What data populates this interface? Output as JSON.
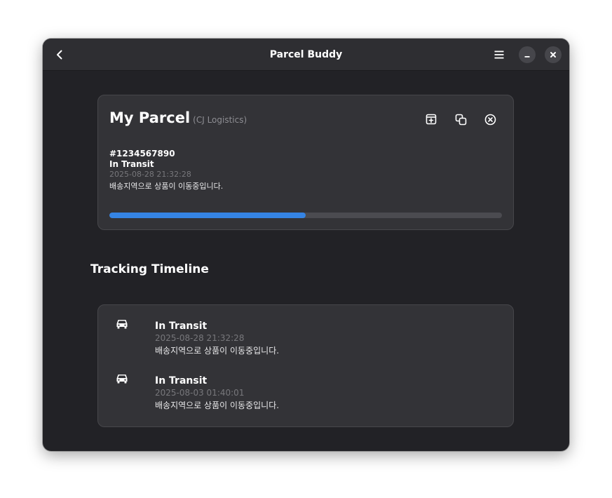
{
  "window": {
    "title": "Parcel Buddy"
  },
  "parcel": {
    "name": "My Parcel",
    "carrier": "(CJ Logistics)",
    "tracking_number": "#1234567890",
    "status": "In Transit",
    "datetime": "2025-08-28 21:32:28",
    "description": "배송지역으로 상품이 이동중입니다.",
    "progress": 0.5
  },
  "timeline": {
    "heading": "Tracking Timeline",
    "events": [
      {
        "icon": "truck-icon",
        "status": "In Transit",
        "datetime": "2025-08-28 21:32:28",
        "description": "배송지역으로 상품이 이동중입니다."
      },
      {
        "icon": "truck-icon",
        "status": "In Transit",
        "datetime": "2025-08-03 01:40:01",
        "description": "배송지역으로 상품이 이동중입니다."
      }
    ]
  },
  "icons": {
    "back": "chevron-left-icon",
    "menu": "hamburger-menu-icon",
    "minimize": "minimize-icon",
    "close": "close-icon",
    "add": "add-to-list-icon",
    "copy": "copy-icon",
    "delete": "delete-circle-icon"
  },
  "colors": {
    "accent": "#3584e4",
    "background": "#222226",
    "card": "#333337"
  }
}
